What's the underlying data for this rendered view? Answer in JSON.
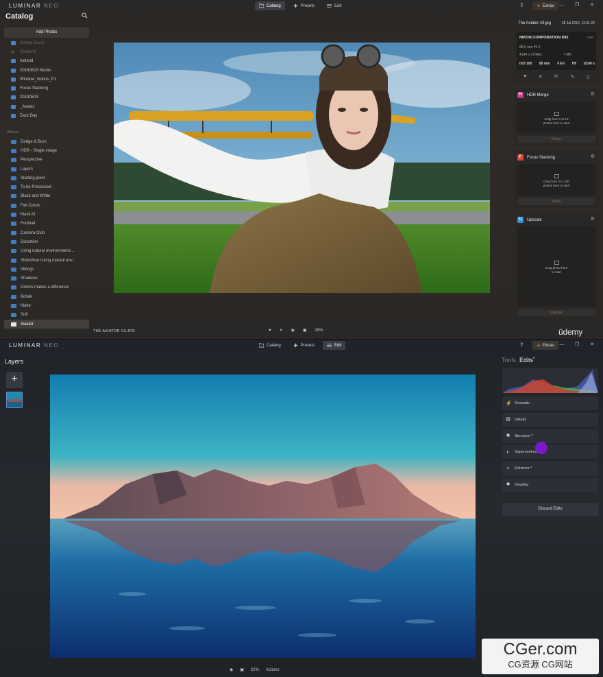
{
  "brand": {
    "word": "LUMINAR",
    "suffix": "NEO"
  },
  "modes": [
    {
      "label": "Catalog",
      "icon": "folder-icon"
    },
    {
      "label": "Presets",
      "icon": "presets-icon"
    },
    {
      "label": "Edit",
      "icon": "sliders-icon"
    }
  ],
  "top_active_mode": "Catalog",
  "bottom_active_mode": "Edit",
  "extras_label": "Extras",
  "catalog": {
    "title": "Catalog",
    "add_photos": "Add Photos",
    "folders": [
      {
        "label": "Ashley Scout",
        "dim": true,
        "icon": "folder-icon"
      },
      {
        "label": "Scotland",
        "dim": true,
        "icon": "warning-icon"
      },
      {
        "label": "Iceland",
        "icon": "folder-icon"
      },
      {
        "label": "20160823 Studio",
        "icon": "folder-icon"
      },
      {
        "label": "Window_Gobos_P1",
        "icon": "folder-icon"
      },
      {
        "label": "Focus Stacking",
        "icon": "folder-icon"
      },
      {
        "label": "20130503",
        "icon": "folder-icon"
      },
      {
        "label": "_Assets",
        "icon": "folder-icon"
      },
      {
        "label": "Zack Day",
        "icon": "folder-icon"
      }
    ],
    "albums_label": "Albums",
    "albums": [
      "Dodge & Burn",
      "HDR - Single image",
      "Perspective",
      "Layers",
      "Starting point",
      "To be Processed",
      "Black and White",
      "Fall Colors",
      "Mask AI",
      "Football",
      "Camera Club",
      "Distortion",
      "Using natural environments...",
      "Slideshow Using natural env...",
      "Vikings",
      "Shadows",
      "Orders makes a difference",
      "Bohek",
      "Matte",
      "Soft",
      "Aviator"
    ],
    "active_album": "Aviator"
  },
  "viewer": {
    "filename": "THE AVIATOR V3.JPG",
    "zoom": "28%"
  },
  "info": {
    "filename": "The Aviator v3.jpg",
    "date": "28 Jul 2019, 12:31:26",
    "camera": "NIKON CORPORATION D81",
    "awb": "AWB",
    "lens": "85.0 mm f/1.4",
    "dimensions": "4144 x 2764px",
    "size": "7 MB",
    "exif": [
      "ISO 100",
      "85 mm",
      "0 EV",
      "f/9",
      "1/160 s"
    ]
  },
  "tools": [
    {
      "name": "HDR Merge",
      "badge": "H",
      "color": "#c43a8f",
      "drop": [
        "Drag from 1 to 10",
        "photos here to start"
      ],
      "action": "Merge",
      "height": 85
    },
    {
      "name": "Focus Stacking",
      "badge": "F",
      "color": "#d44a3a",
      "drop": [
        "Drag from 2 to 100",
        "photos here to start"
      ],
      "action": "Stack",
      "height": 85
    },
    {
      "name": "Upscale",
      "badge": "U",
      "color": "#3a8fd4",
      "drop": [
        "Drag photo here",
        "to start"
      ],
      "action": "Upscale",
      "height": 156
    }
  ],
  "watermark_udemy": "ûdemy",
  "layers": {
    "title": "Layers"
  },
  "edit_tabs": [
    {
      "label": "Tools",
      "active": false
    },
    {
      "label": "Edits",
      "active": true,
      "dot": "•"
    }
  ],
  "edits": [
    {
      "label": "Dramatic",
      "icon": "lightning-icon"
    },
    {
      "label": "Details",
      "icon": "details-icon"
    },
    {
      "label": "Structure *",
      "icon": "sun-icon"
    },
    {
      "label": "Supercontrast",
      "icon": "contrast-icon"
    },
    {
      "label": "Enhance *",
      "icon": "wand-icon"
    },
    {
      "label": "Develop",
      "icon": "develop-icon"
    }
  ],
  "discard_edits": "Discard Edits",
  "bottom_viewer": {
    "zoom": "22%",
    "actions": "Actions"
  },
  "site_watermark": {
    "big": "CGer.com",
    "small": "CG资源 CG网站"
  }
}
